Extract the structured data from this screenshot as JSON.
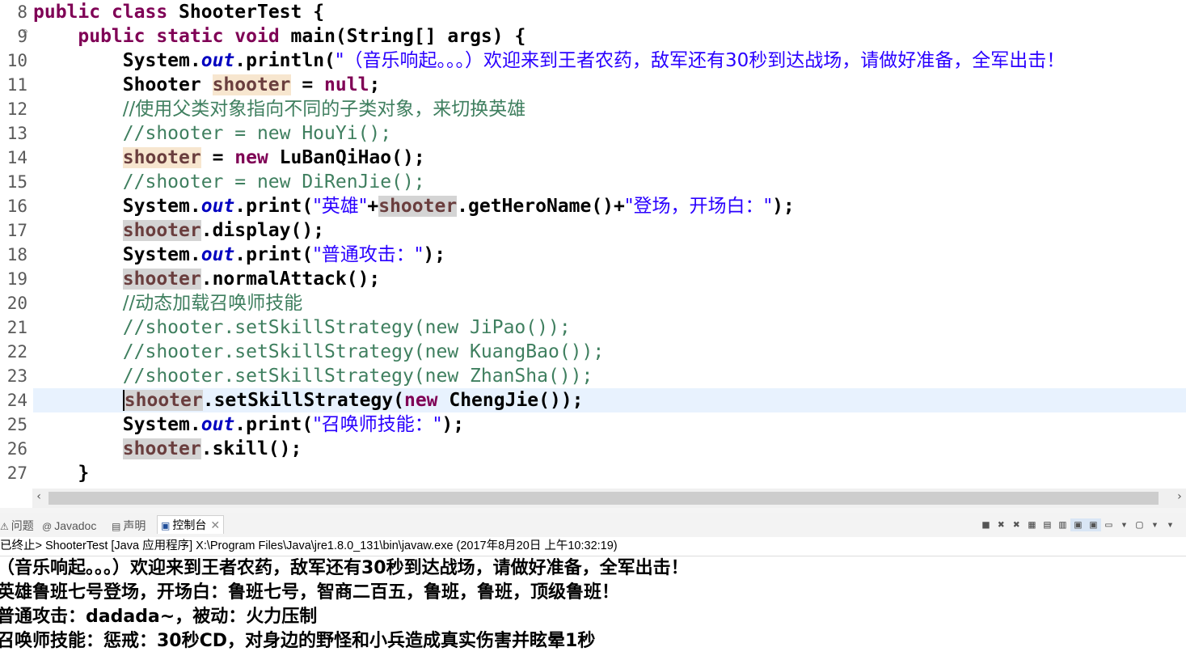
{
  "editor": {
    "lines": [
      {
        "num": "8"
      },
      {
        "num": "9"
      },
      {
        "num": "10"
      },
      {
        "num": "11"
      },
      {
        "num": "12"
      },
      {
        "num": "13"
      },
      {
        "num": "14"
      },
      {
        "num": "15"
      },
      {
        "num": "16"
      },
      {
        "num": "17"
      },
      {
        "num": "18"
      },
      {
        "num": "19"
      },
      {
        "num": "20"
      },
      {
        "num": "21"
      },
      {
        "num": "22"
      },
      {
        "num": "23"
      },
      {
        "num": "24"
      },
      {
        "num": "25"
      },
      {
        "num": "26"
      },
      {
        "num": "27"
      }
    ],
    "t": {
      "public": "public",
      "class": "class",
      "static": "static",
      "void": "void",
      "new": "new",
      "null": "null",
      "out": "out",
      "shooter": "shooter",
      "l8_rest": " ShooterTest {",
      "l9_rest": " main(String[] args) {",
      "system": "System.",
      "println": ".println(",
      "print": ".print(",
      "l10_str": "\"（音乐响起。。。）欢迎来到王者农药，敌军还有30秒到达战场，请做好准备，全军出击！",
      "l11_type": "Shooter ",
      "l11_mid": " = ",
      "l11_end": ";",
      "l12_cmt": "//使用父类对象指向不同的子类对象，来切换英雄",
      "l13_cmt": "//shooter = new HouYi();",
      "l14_mid": " = ",
      "l14_end": " LuBanQiHao();",
      "l15_cmt": "//shooter = new DiRenJie();",
      "l16_open": "(",
      "l16_str1": "\"英雄\"",
      "l16_plus": "+",
      "l16_mid": ".getHeroName()+",
      "l16_str2": "\"登场，开场白：\"",
      "close": ");",
      "l17_rest": ".display();",
      "l18_str": "\"普通攻击：\"",
      "l19_rest": ".normalAttack();",
      "l20_cmt": "//动态加载召唤师技能",
      "l21_cmt": "//shooter.setSkillStrategy(new JiPao());",
      "l22_cmt": "//shooter.setSkillStrategy(new KuangBao());",
      "l23_cmt": "//shooter.setSkillStrategy(new ZhanSha());",
      "l24_mid": ".setSkillStrategy(",
      "l24_end": " ChengJie());",
      "l25_str": "\"召唤师技能：\"",
      "l26_rest": ".skill();",
      "l27": "    }"
    }
  },
  "panel": {
    "tabs": [
      {
        "label": "问题",
        "icon": "problems-icon"
      },
      {
        "label": "Javadoc",
        "icon": "javadoc-icon"
      },
      {
        "label": "声明",
        "icon": "declaration-icon"
      },
      {
        "label": "控制台",
        "icon": "console-icon",
        "active": true
      }
    ],
    "status": "已终止> ShooterTest [Java 应用程序] X:\\Program Files\\Java\\jre1.8.0_131\\bin\\javaw.exe (2017年8月20日 上午10:32:19)",
    "output": [
      "（音乐响起。。。）欢迎来到王者农药，敌军还有30秒到达战场，请做好准备，全军出击！",
      "英雄鲁班七号登场，开场白：鲁班七号，智商二百五，鲁班，鲁班，顶级鲁班！",
      "普通攻击：dadada~，被动：火力压制",
      "召唤师技能：惩戒：30秒CD，对身边的野怪和小兵造成真实伤害并眩晕1秒"
    ],
    "toolbar_icons": [
      "terminate-icon",
      "remove-launch-icon",
      "remove-all-icon",
      "scroll-lock-icon",
      "word-wrap-icon",
      "show-stdout-icon",
      "show-stderr-icon",
      "pin-console-icon",
      "display-console-icon",
      "dropdown-icon",
      "open-console-icon",
      "dropdown-icon",
      "view-menu-icon"
    ]
  }
}
